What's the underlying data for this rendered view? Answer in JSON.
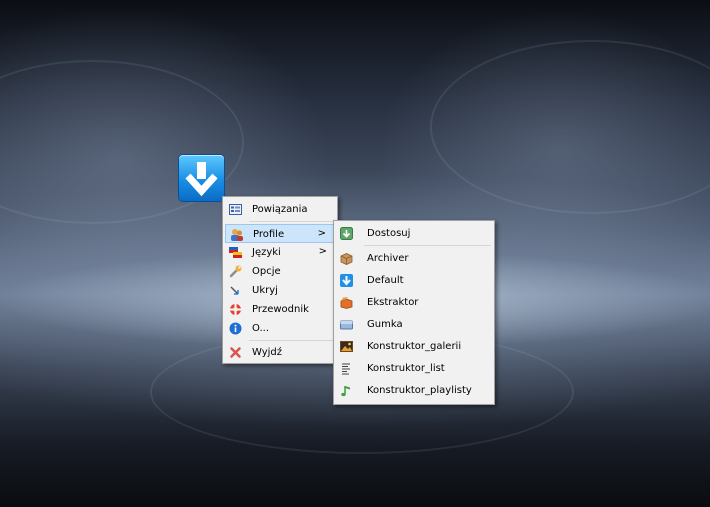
{
  "main_menu": {
    "items": [
      {
        "label": "Powiązania",
        "icon": "links-icon"
      },
      {
        "label": "Profile",
        "icon": "profiles-icon",
        "has_submenu": true
      },
      {
        "label": "Języki",
        "icon": "languages-icon",
        "has_submenu": true
      },
      {
        "label": "Opcje",
        "icon": "options-icon"
      },
      {
        "label": "Ukryj",
        "icon": "hide-icon"
      },
      {
        "label": "Przewodnik",
        "icon": "guide-icon"
      },
      {
        "label": "O...",
        "icon": "about-icon"
      },
      {
        "label": "Wyjdź",
        "icon": "exit-icon"
      }
    ],
    "submenu_arrow": ">"
  },
  "profile_submenu": {
    "items": [
      {
        "label": "Dostosuj"
      },
      {
        "label": "Archiver"
      },
      {
        "label": "Default"
      },
      {
        "label": "Ekstraktor"
      },
      {
        "label": "Gumka"
      },
      {
        "label": "Konstruktor_galerii"
      },
      {
        "label": "Konstruktor_list"
      },
      {
        "label": "Konstruktor_playlisty"
      }
    ]
  },
  "colors": {
    "highlight": "#cce5fb",
    "menu_bg": "#f1f1f1",
    "app_icon": "#1a8ee6"
  }
}
